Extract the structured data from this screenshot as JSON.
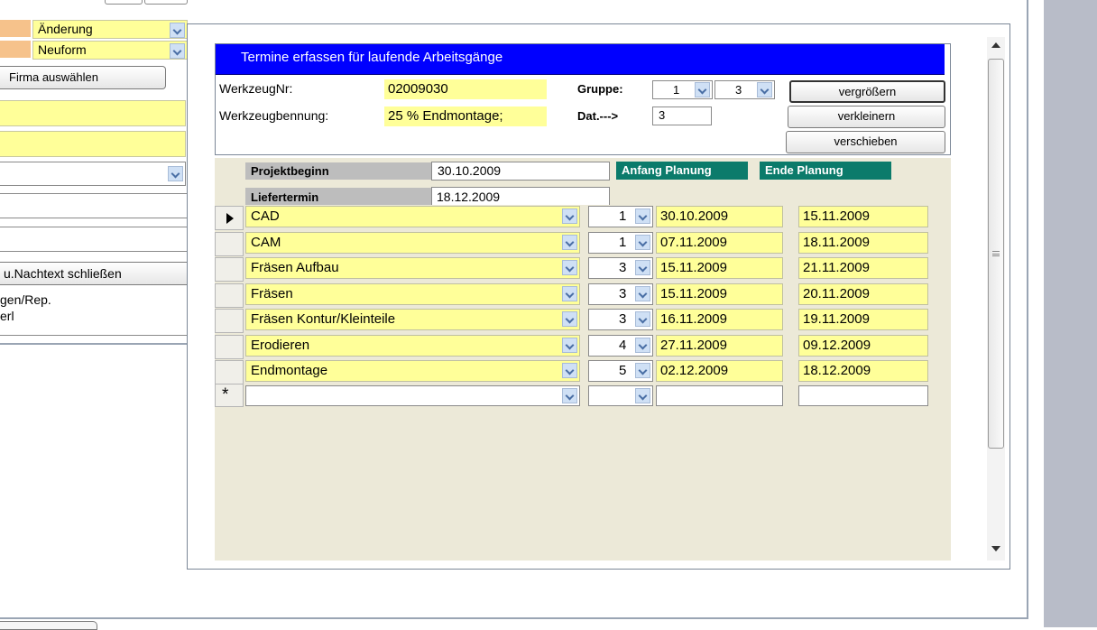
{
  "left_panel": {
    "aenderung": "Änderung",
    "neuform": "Neuform",
    "firma_button": "Firma auswählen",
    "nachtext_button": "u.Nachtext schließen",
    "list_line1": "gen/Rep.",
    "list_line2": "erl"
  },
  "form": {
    "title": "Termine erfassen für laufende Arbeitsgänge",
    "werkzeugnr_label": "WerkzeugNr:",
    "werkzeugnr_value": "02009030",
    "werkzeugbennung_label": "Werkzeugbennung:",
    "werkzeugbennung_value": "25 % Endmontage;",
    "gruppe_label": "Gruppe:",
    "gruppe_1": "1",
    "gruppe_2": "3",
    "dat_label": "Dat.--->",
    "dat_value": "3",
    "btn_vergroessern": "vergrößern",
    "btn_verkleinern": "verkleinern",
    "btn_verschieben": "verschieben",
    "projektbeginn_label": "Projektbeginn",
    "projektbeginn_value": "30.10.2009",
    "liefertermin_label": "Liefertermin",
    "liefertermin_value": "18.12.2009",
    "anfang_planung": "Anfang Planung",
    "ende_planung": "Ende Planung",
    "new_row_marker": "*"
  },
  "rows": [
    {
      "name": "CAD",
      "num": "1",
      "start": "30.10.2009",
      "end": "15.11.2009"
    },
    {
      "name": "CAM",
      "num": "1",
      "start": "07.11.2009",
      "end": "18.11.2009"
    },
    {
      "name": "Fräsen Aufbau",
      "num": "3",
      "start": "15.11.2009",
      "end": "21.11.2009"
    },
    {
      "name": "Fräsen",
      "num": "3",
      "start": "15.11.2009",
      "end": "20.11.2009"
    },
    {
      "name": "Fräsen Kontur/Kleinteile",
      "num": "3",
      "start": "16.11.2009",
      "end": "19.11.2009"
    },
    {
      "name": "Erodieren",
      "num": "4",
      "start": "27.11.2009",
      "end": "09.12.2009"
    },
    {
      "name": "Endmontage",
      "num": "5",
      "start": "02.12.2009",
      "end": "18.12.2009"
    }
  ],
  "colors": {
    "title_bar": "#0000ff",
    "field_yellow": "#ffff99",
    "teal": "#0b7b6b",
    "detail_bg": "#ece9d8"
  }
}
